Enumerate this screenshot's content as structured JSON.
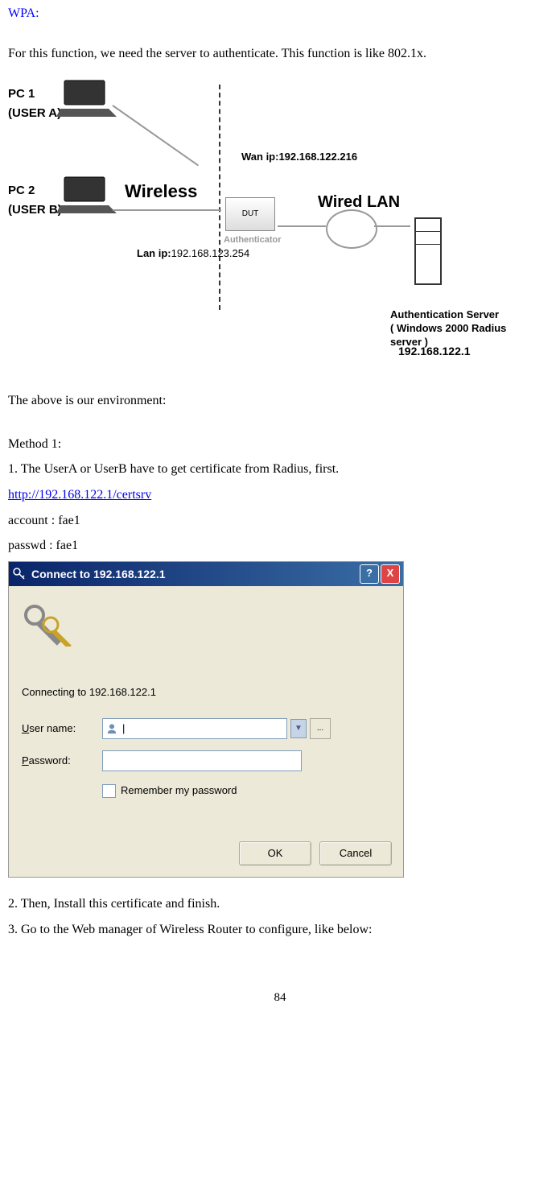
{
  "heading": "WPA:",
  "intro_text": "For this function, we need the server to authenticate. This function is like 802.1x.",
  "diagram": {
    "pc1_line1": "PC 1",
    "pc1_line2": "(USER A)",
    "pc2_line1": "PC 2",
    "pc2_line2": "(USER B)",
    "wireless_label": "Wireless",
    "wan_ip_label": "Wan ip:192.168.122.216",
    "dut_label": "DUT",
    "authenticator_label": "Authenticator",
    "lan_ip_prefix": "Lan ip:",
    "lan_ip_value": "192.168.123.254",
    "wired_label": "Wired  LAN",
    "server_line1": "Authentication Server",
    "server_line2": "( Windows 2000 Radius server )",
    "server_ip": "192.168.122.1"
  },
  "environment_text": "The above is our environment:",
  "method1": {
    "heading": "Method 1:",
    "step1": "1. The UserA or UserB have to get certificate from Radius, first.",
    "link": "http://192.168.122.1/certsrv",
    "account_line": "account : fae1",
    "passwd_line": "passwd : fae1"
  },
  "dialog": {
    "title": "Connect to 192.168.122.1",
    "connecting_text": "Connecting to 192.168.122.1",
    "username_label": "User name:",
    "username_value": "",
    "password_label": "Password:",
    "password_value": "",
    "remember_label": "Remember my password",
    "ok_label": "OK",
    "cancel_label": "Cancel",
    "help_symbol": "?",
    "close_symbol": "X"
  },
  "step2": "2. Then, Install this certificate and finish.",
  "step3": "3. Go to the Web manager of Wireless Router to configure, like below:",
  "page_number": "84"
}
